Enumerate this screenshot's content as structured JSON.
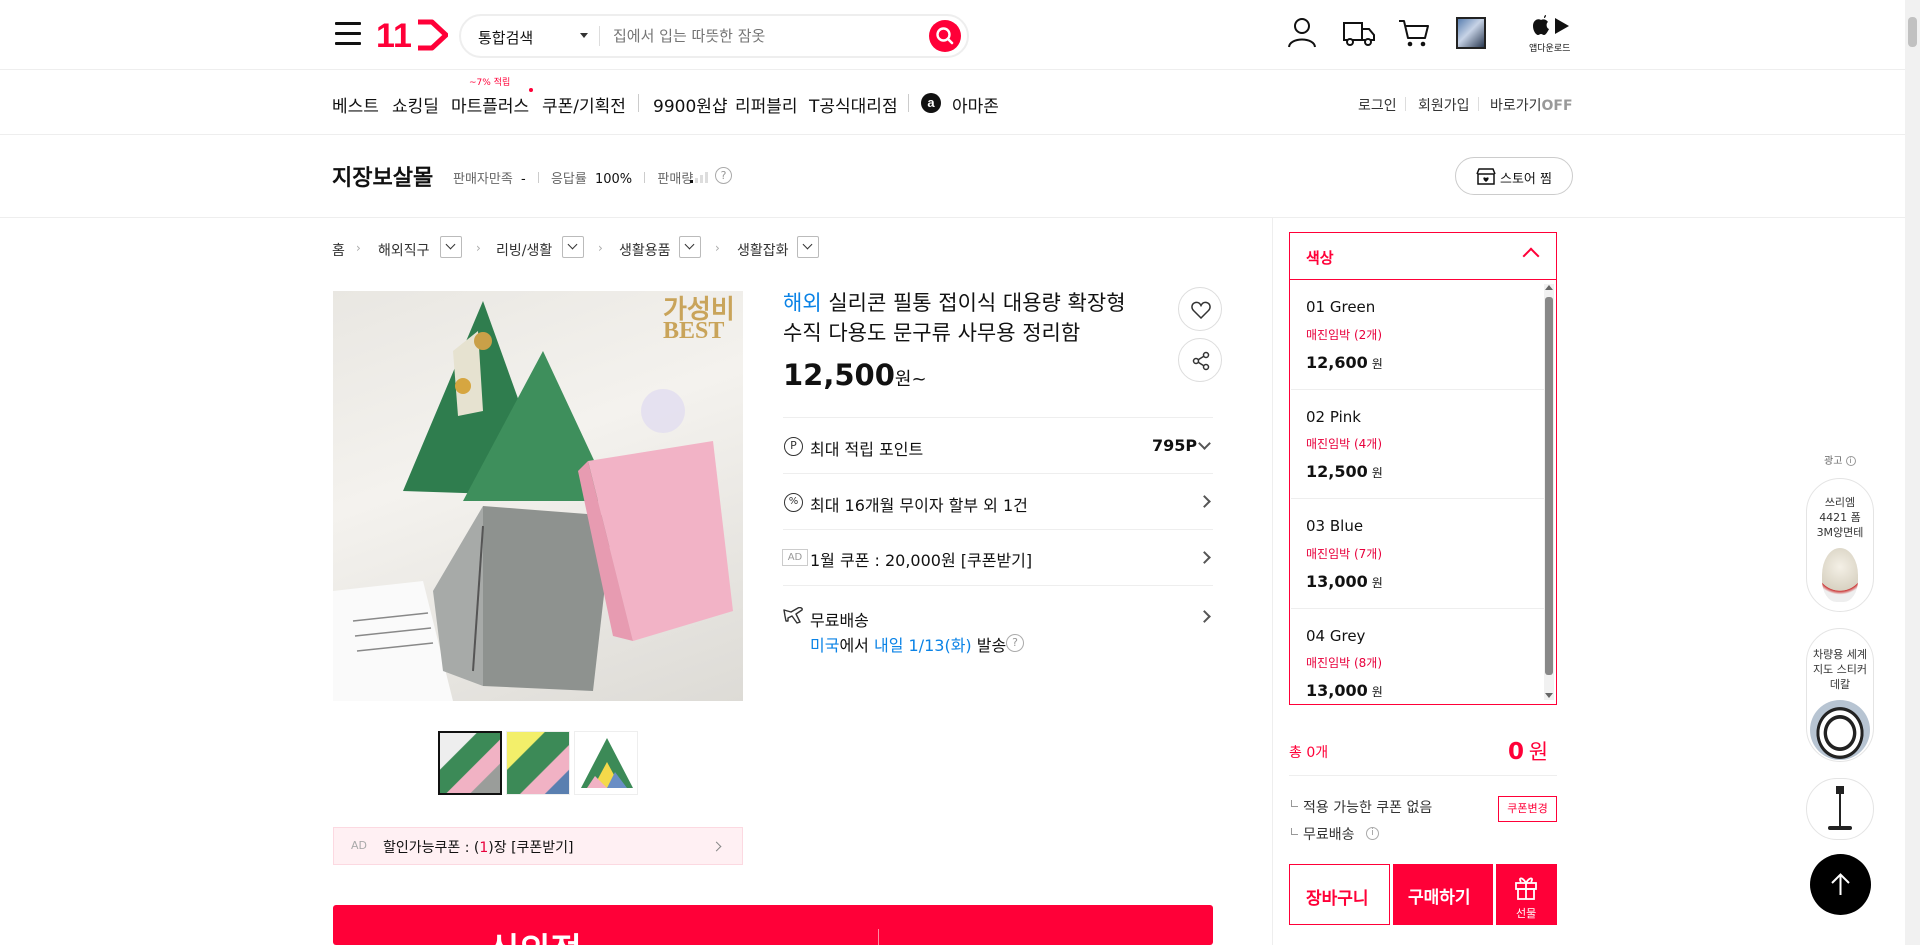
{
  "header": {
    "logo": "11",
    "search_category": "통합검색",
    "search_placeholder": "집에서 입는 따뜻한 잠옷",
    "app_download": "앱다운로드"
  },
  "nav": {
    "items": [
      "베스트",
      "쇼킹딜",
      "마트플러스",
      "쿠폰/기획전",
      "9900원샵",
      "리퍼블리",
      "T공식대리점",
      "아마존"
    ],
    "mart_badge": "~7% 적립",
    "login": "로그인",
    "signup": "회원가입",
    "shortcut": "바로가기",
    "shortcut_state": "OFF"
  },
  "store": {
    "name": "지장보살몰",
    "satisfaction_label": "판매자만족",
    "satisfaction_value": "-",
    "response_label": "응답률",
    "response_value": "100%",
    "sales_label": "판매량",
    "follow_label": "스토어 찜"
  },
  "breadcrumb": [
    "홈",
    "해외직구",
    "리빙/생활",
    "생활용품",
    "생활잡화"
  ],
  "product": {
    "badge": "해외",
    "title_line1": "실리콘 필통 접이식 대용량 확장형",
    "title_line2": "수직 다용도 문구류 사무용 정리함",
    "price": "12,500",
    "price_unit": "원~",
    "image_overlay_1": "가성비",
    "image_overlay_2": "BEST",
    "point_label": "최대 적립 포인트",
    "point_value": "795P",
    "installment": "최대 16개월 무이자 할부 외 1건",
    "coupon_ad": "AD",
    "coupon_text": "1월 쿠폰 : 20,000원 [쿠폰받기]",
    "shipping_label": "무료배송",
    "ship_origin": "미국",
    "ship_from": "에서",
    "ship_date": "내일 1/13(화)",
    "ship_suffix": "발송",
    "discount_ad": "AD",
    "discount_prefix": "할인가능쿠폰 : (",
    "discount_count": "1",
    "discount_suffix": ")장 [쿠폰받기]"
  },
  "options": {
    "header": "색상",
    "items": [
      {
        "name": "01 Green",
        "stock": "매진임박 (2개)",
        "price": "12,600",
        "won": "원"
      },
      {
        "name": "02 Pink",
        "stock": "매진임박 (4개)",
        "price": "12,500",
        "won": "원"
      },
      {
        "name": "03 Blue",
        "stock": "매진임박 (7개)",
        "price": "13,000",
        "won": "원"
      },
      {
        "name": "04 Grey",
        "stock": "매진임박 (8개)",
        "price": "13,000",
        "won": "원"
      }
    ]
  },
  "order": {
    "total_label": "총 0개",
    "total_value": "0",
    "total_unit": "원",
    "no_coupon": "적용 가능한 쿠폰 없음",
    "coupon_change": "쿠폰변경",
    "free_shipping": "무료배송",
    "cart": "장바구니",
    "buy": "구매하기",
    "gift": "선물"
  },
  "ads": {
    "label": "광고",
    "card1": "쓰리엠 4421 폼 3M양면테",
    "card2": "차량용 세계지도 스티커 데칼"
  },
  "banner": {
    "text": "신의정"
  },
  "colors": {
    "brand": "#ff0038",
    "blue": "#0b83e6",
    "red": "#e8003c"
  }
}
